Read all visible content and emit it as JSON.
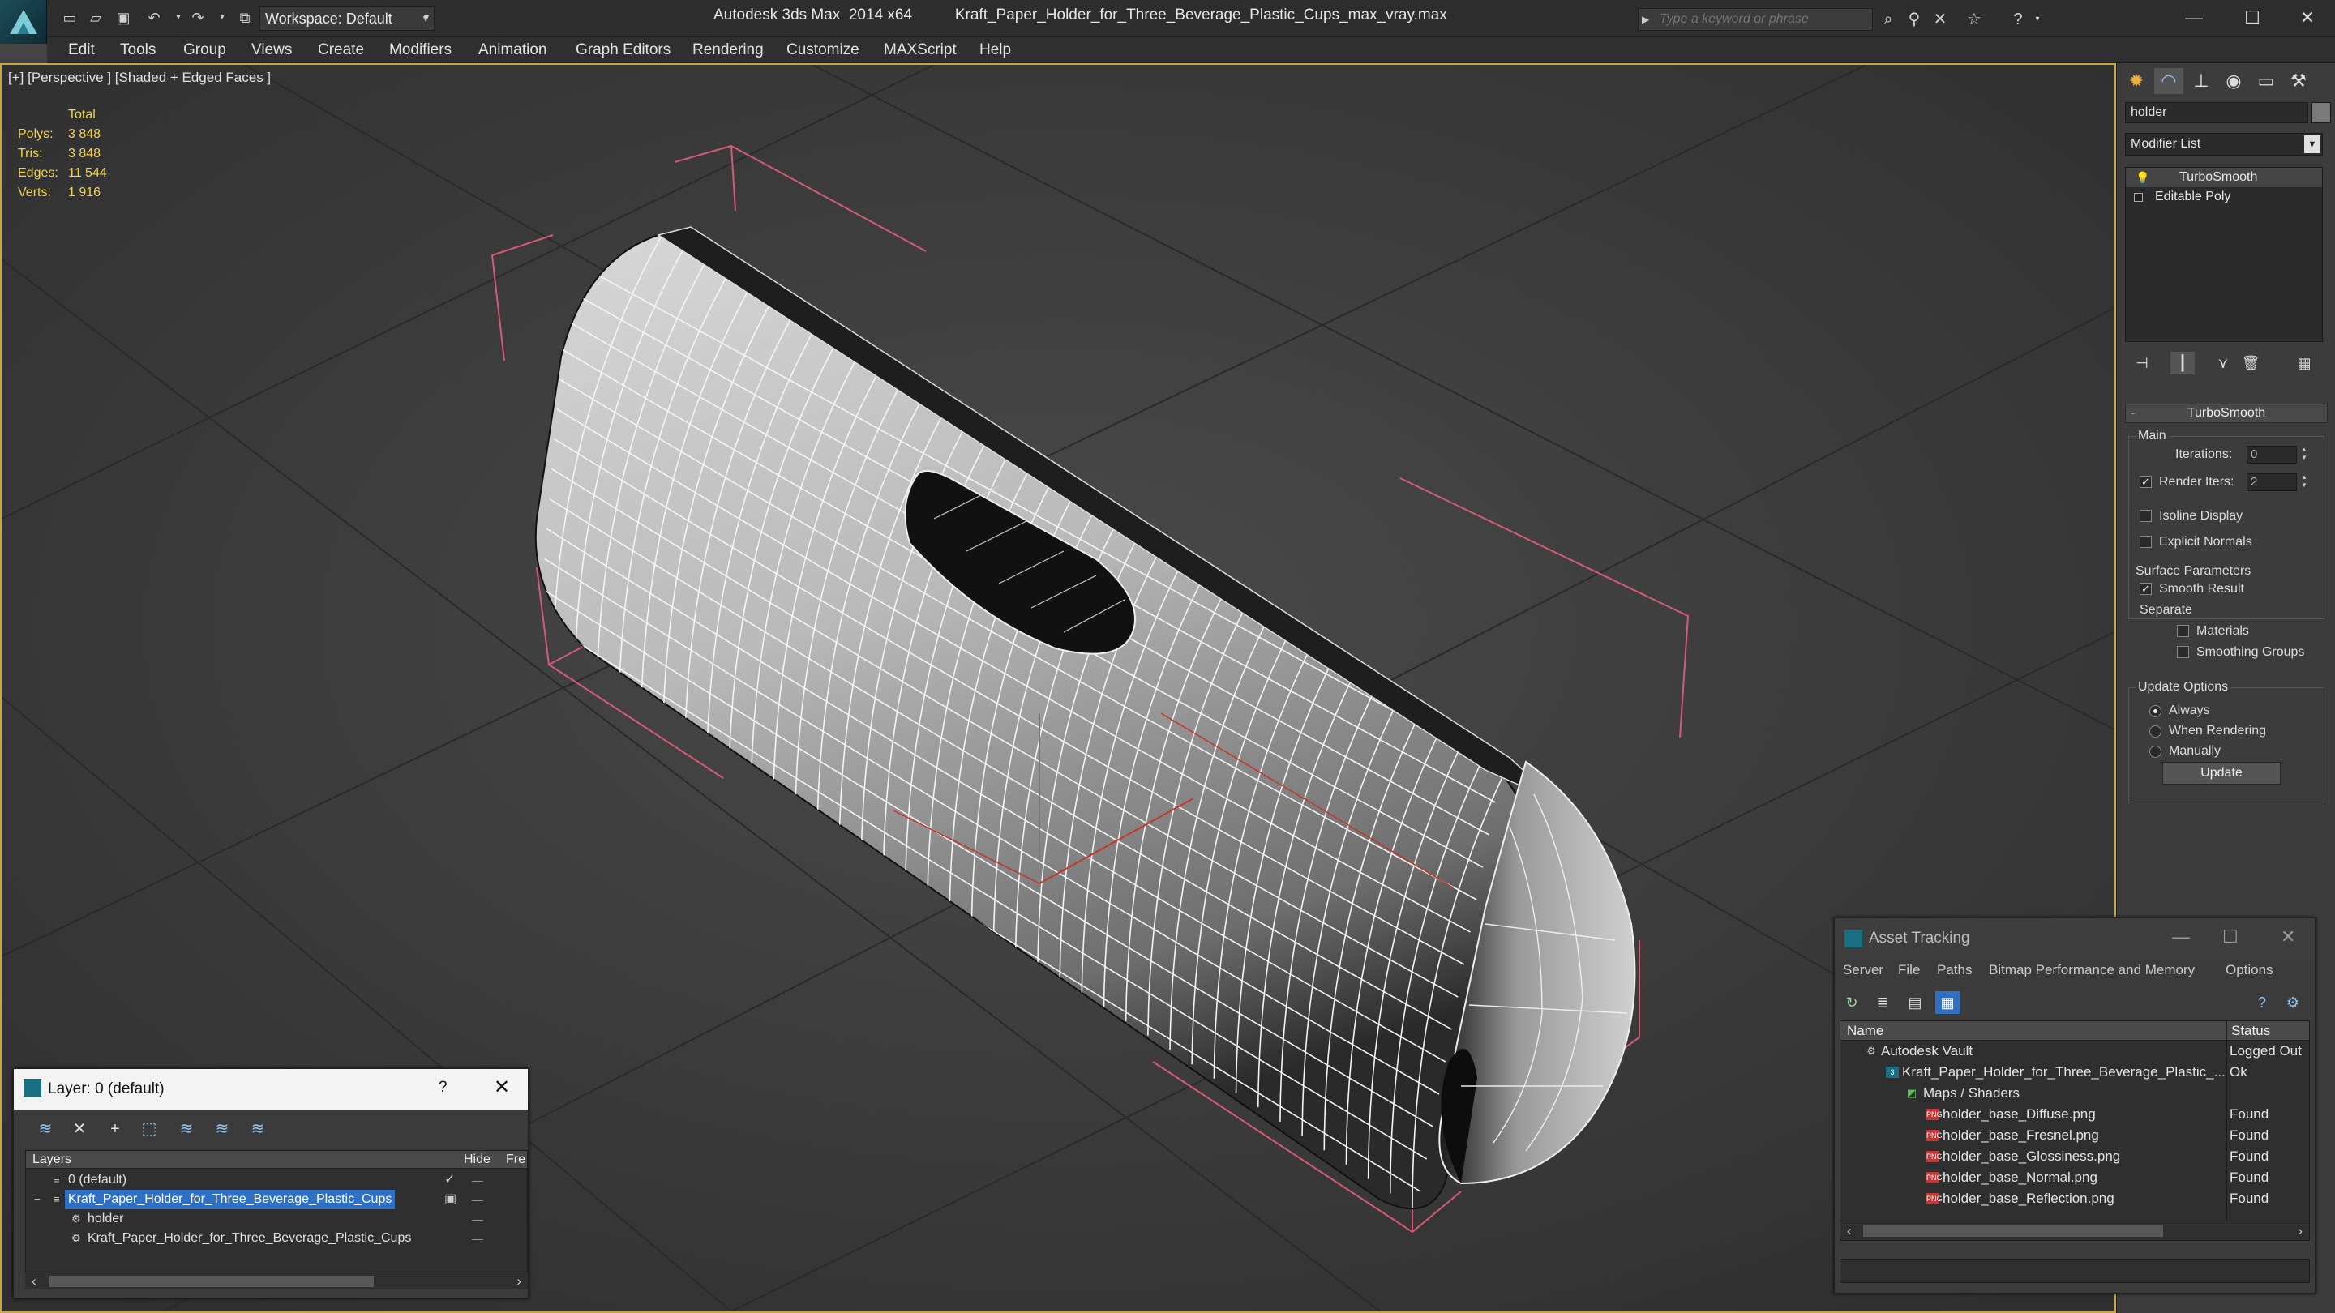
{
  "titlebar": {
    "workspace": "Workspace: Default",
    "app_title": "Autodesk 3ds Max  2014 x64",
    "file_title": "Kraft_Paper_Holder_for_Three_Beverage_Plastic_Cups_max_vray.max",
    "search_placeholder": "Type a keyword or phrase"
  },
  "menu": [
    "Edit",
    "Tools",
    "Group",
    "Views",
    "Create",
    "Modifiers",
    "Animation",
    "Graph Editors",
    "Rendering",
    "Customize",
    "MAXScript",
    "Help"
  ],
  "viewport": {
    "label": "[+] [Perspective ] [Shaded + Edged Faces ]",
    "stats": {
      "total_label": "Total",
      "polys_label": "Polys:",
      "polys": "3 848",
      "tris_label": "Tris:",
      "tris": "3 848",
      "edges_label": "Edges:",
      "edges": "11 544",
      "verts_label": "Verts:",
      "verts": "1 916"
    },
    "accent_color": "#c9a73a"
  },
  "command_panel": {
    "object_name": "holder",
    "modifier_list": "Modifier List",
    "stack": [
      "TurboSmooth",
      "Editable Poly"
    ],
    "rollout_title": "TurboSmooth",
    "main_group": "Main",
    "iterations_label": "Iterations:",
    "iterations": "0",
    "render_iters_label": "Render Iters:",
    "render_iters": "2",
    "render_iters_checked": true,
    "isoline_label": "Isoline Display",
    "explicit_normals_label": "Explicit Normals",
    "surface_params_group": "Surface Parameters",
    "smooth_result_label": "Smooth Result",
    "separate_label": "Separate",
    "materials_label": "Materials",
    "smoothing_groups_label": "Smoothing Groups",
    "update_options_group": "Update Options",
    "always_label": "Always",
    "when_rendering_label": "When Rendering",
    "manually_label": "Manually",
    "update_button": "Update"
  },
  "layer_dialog": {
    "title": "Layer: 0 (default)",
    "help": "?",
    "col_layers": "Layers",
    "col_hide": "Hide",
    "col_freeze": "Fre",
    "rows": [
      {
        "name": "0 (default)",
        "indent": 0,
        "selected": false
      },
      {
        "name": "Kraft_Paper_Holder_for_Three_Beverage_Plastic_Cups",
        "indent": 0,
        "selected": true
      },
      {
        "name": "holder",
        "indent": 1,
        "selected": false
      },
      {
        "name": "Kraft_Paper_Holder_for_Three_Beverage_Plastic_Cups",
        "indent": 1,
        "selected": false
      }
    ]
  },
  "asset_dialog": {
    "title": "Asset Tracking",
    "menu": [
      "Server",
      "File",
      "Paths",
      "Bitmap Performance and Memory",
      "Options"
    ],
    "col_name": "Name",
    "col_status": "Status",
    "rows": [
      {
        "name": "Autodesk Vault",
        "status": "Logged Out",
        "indent": 0,
        "icon": "vault"
      },
      {
        "name": "Kraft_Paper_Holder_for_Three_Beverage_Plastic_...",
        "status": "Ok",
        "indent": 1,
        "icon": "max"
      },
      {
        "name": "Maps / Shaders",
        "status": "",
        "indent": 2,
        "icon": "folder"
      },
      {
        "name": "holder_base_Diffuse.png",
        "status": "Found",
        "indent": 3,
        "icon": "png"
      },
      {
        "name": "holder_base_Fresnel.png",
        "status": "Found",
        "indent": 3,
        "icon": "png"
      },
      {
        "name": "holder_base_Glossiness.png",
        "status": "Found",
        "indent": 3,
        "icon": "png"
      },
      {
        "name": "holder_base_Normal.png",
        "status": "Found",
        "indent": 3,
        "icon": "png"
      },
      {
        "name": "holder_base_Reflection.png",
        "status": "Found",
        "indent": 3,
        "icon": "png"
      }
    ]
  }
}
